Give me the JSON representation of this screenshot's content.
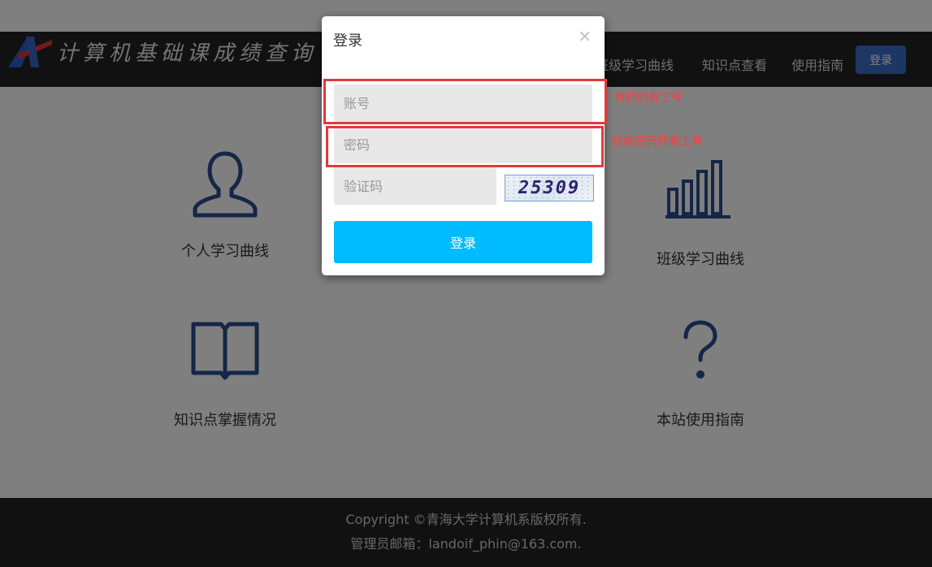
{
  "site": {
    "brand_text": "计算机基础课成绩查询",
    "nav": {
      "items": [
        "班级学习曲线",
        "知识点查看",
        "使用指南"
      ],
      "login_label": "登录"
    }
  },
  "features": [
    {
      "label": "个人学习曲线",
      "icon": "user-icon"
    },
    {
      "label": "班级学习曲线",
      "icon": "bar-chart-icon"
    },
    {
      "label": "知识点掌握情况",
      "icon": "book-icon"
    },
    {
      "label": "本站使用指南",
      "icon": "question-icon"
    }
  ],
  "footer": {
    "copyright": "Copyright ©青海大学计算机系版权所有.",
    "contact": "管理员邮箱：landoif_phin@163.com."
  },
  "login_modal": {
    "title": "登录",
    "close": "×",
    "account_placeholder": "账号",
    "password_placeholder": "密码",
    "captcha_placeholder": "验证码",
    "captcha_code": "25309",
    "submit_label": "登录"
  },
  "annotations": {
    "account_note": "教师的教工号",
    "password_note": "初始密码同教工号",
    "highlight_color": "#e03a3a"
  },
  "colors": {
    "navbar": "#222222",
    "accent_button": "#00bbff",
    "nav_login": "#3b6fc9",
    "icon_blue": "#2a4d8f"
  }
}
